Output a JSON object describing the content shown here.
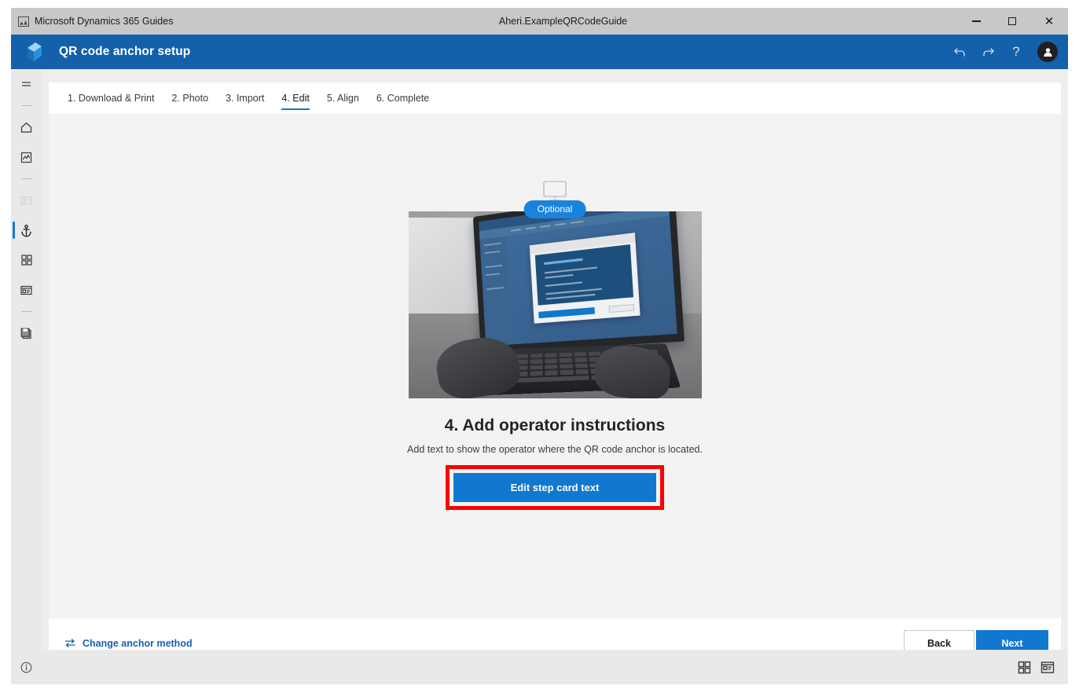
{
  "titlebar": {
    "app_icon": "picture-icon",
    "app_name": "Microsoft Dynamics 365 Guides",
    "document_title": "Aheri.ExampleQRCodeGuide",
    "minimize_label": "Minimize",
    "maximize_label": "Restore",
    "close_label": "Close"
  },
  "header": {
    "logo": "dynamics-guides-logo",
    "title": "QR code anchor setup",
    "accent_color": "#1460ab",
    "actions": [
      {
        "name": "undo-icon",
        "label": "Undo"
      },
      {
        "name": "redo-icon",
        "label": "Redo"
      },
      {
        "name": "help-icon",
        "label": "?"
      },
      {
        "name": "account-avatar",
        "label": "Account"
      }
    ]
  },
  "sidebar": {
    "items": [
      {
        "name": "hamburger-menu-icon",
        "label": "Menu",
        "selected": false
      },
      {
        "name": "home-icon",
        "label": "Home",
        "selected": false
      },
      {
        "name": "media-icon",
        "label": "Media",
        "selected": false
      },
      {
        "name": "steps-icon",
        "label": "Steps",
        "selected": false
      },
      {
        "name": "anchor-icon",
        "label": "Anchor",
        "selected": true
      },
      {
        "name": "grid-icon",
        "label": "Assets",
        "selected": false
      },
      {
        "name": "card-icon",
        "label": "Step card",
        "selected": false
      },
      {
        "name": "save-icon",
        "label": "Save",
        "selected": false
      }
    ]
  },
  "tabs": [
    {
      "label": "1. Download & Print",
      "active": false
    },
    {
      "label": "2. Photo",
      "active": false
    },
    {
      "label": "3. Import",
      "active": false
    },
    {
      "label": "4. Edit",
      "active": true
    },
    {
      "label": "5. Align",
      "active": false
    },
    {
      "label": "6. Complete",
      "active": false
    }
  ],
  "main": {
    "device_icon": "desktop-monitor-icon",
    "badge": "Optional",
    "photo_alt": "Hands typing on a laptop showing the QR code anchor dialog",
    "heading": "4. Add operator instructions",
    "description": "Add text to show the operator where the QR code anchor is located.",
    "cta_label": "Edit step card text",
    "highlight_color": "#fb0000"
  },
  "footer": {
    "change_anchor_icon": "swap-arrows-icon",
    "change_anchor_label": "Change anchor method",
    "back_label": "Back",
    "next_label": "Next"
  },
  "statusbar": {
    "info_icon": "info-icon",
    "views": [
      {
        "name": "grid-view-icon",
        "label": "Grid view"
      },
      {
        "name": "detail-view-icon",
        "label": "Detail view"
      }
    ]
  }
}
